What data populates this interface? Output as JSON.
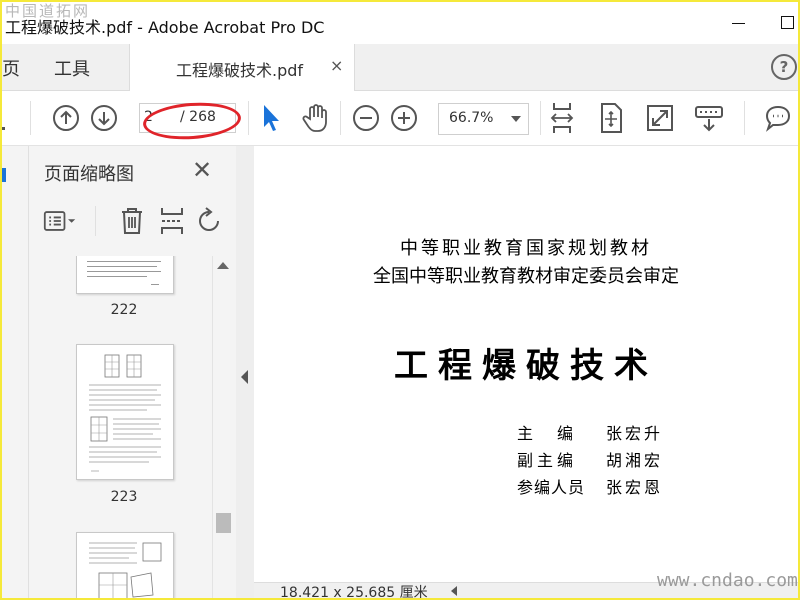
{
  "watermark_top": "中国道拓网",
  "window": {
    "title": "工程爆破技术.pdf - Adobe Acrobat Pro DC"
  },
  "menu": {
    "home": "页",
    "tools": "工具"
  },
  "tab": {
    "label": "工程爆破技术.pdf",
    "close": "×"
  },
  "help": "?",
  "toolbar": {
    "page_current": "2",
    "page_total": "/ 268",
    "zoom": "66.7%"
  },
  "panel": {
    "title": "页面缩略图",
    "close": "✕",
    "thumbnails": [
      {
        "label": "222"
      },
      {
        "label": "223"
      }
    ]
  },
  "document": {
    "line1": "中等职业教育国家规划教材",
    "line2": "全国中等职业教育教材审定委员会审定",
    "title": "工程爆破技术",
    "credits": [
      {
        "role": "主　编",
        "name": "张宏升"
      },
      {
        "role": "副主编",
        "name": "胡湘宏"
      },
      {
        "role": "参编人员",
        "name": "张宏恩"
      }
    ]
  },
  "status": {
    "page_size": "18.421 x 25.685 厘米"
  },
  "watermark_bottom": "www.cndao.com",
  "colors": {
    "accent_blue": "#1a73d9",
    "annotation_red": "#e0242a",
    "frame_yellow": "#f5e93a"
  }
}
